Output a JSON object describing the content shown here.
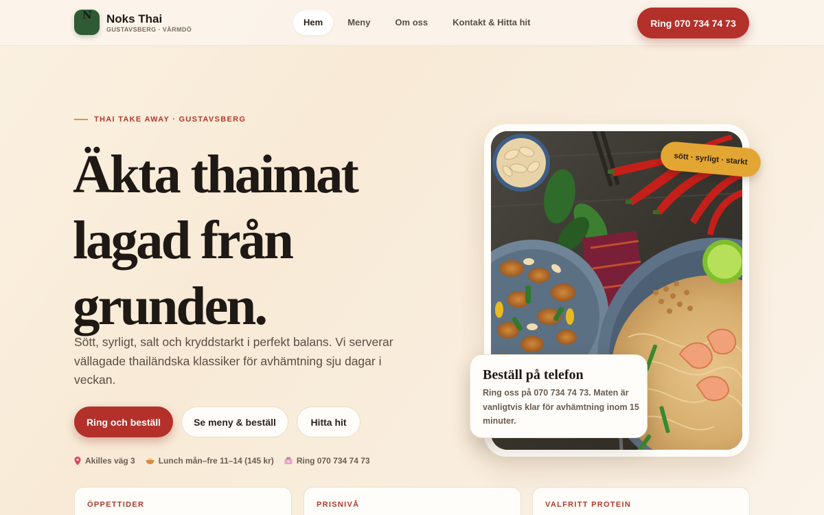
{
  "brand": {
    "logo_letter": "N",
    "name": "Noks Thai",
    "subtitle": "GUSTAVSBERG · VÄRMDÖ"
  },
  "nav": {
    "links": [
      {
        "label": "Hem",
        "active": true
      },
      {
        "label": "Meny",
        "active": false
      },
      {
        "label": "Om oss",
        "active": false
      },
      {
        "label": "Kontakt & Hitta hit",
        "active": false
      }
    ],
    "call_label": "Ring 070 734 74 73"
  },
  "hero": {
    "eyebrow": "THAI TAKE AWAY · GUSTAVSBERG",
    "headline": [
      "Äkta thaimat",
      "lagad från",
      "grunden."
    ],
    "lead": "Sött, syrligt, salt och kryddstarkt i perfekt balans. Vi serverar vällagade thailändska klassiker för avhämtning sju dagar i veckan.",
    "buttons": {
      "primary": "Ring och beställ",
      "menu": "Se meny & beställ",
      "find": "Hitta hit"
    },
    "info": [
      {
        "icon": "map-pin-icon",
        "text": "Akilles väg 3"
      },
      {
        "icon": "bowl-icon",
        "text": "Lunch mån–fre 11–14 (145 kr)"
      },
      {
        "icon": "phone-icon",
        "text": "Ring 070 734 74 73"
      }
    ]
  },
  "photo": {
    "tag": "sött · syrligt · starkt",
    "order_card": {
      "title": "Beställ på telefon",
      "text": "Ring oss på 070 734 74 73. Maten är vanligtvis klar för avhämtning inom 15 minuter."
    }
  },
  "cards": [
    {
      "label": "ÖPPETTIDER"
    },
    {
      "label": "PRISNIVÅ"
    },
    {
      "label": "VALFRITT PROTEIN"
    }
  ],
  "colors": {
    "accent_red": "#b3312a",
    "accent_gold": "#e3a632",
    "logo_green": "#2e5a34",
    "background": "#f8ead6"
  }
}
